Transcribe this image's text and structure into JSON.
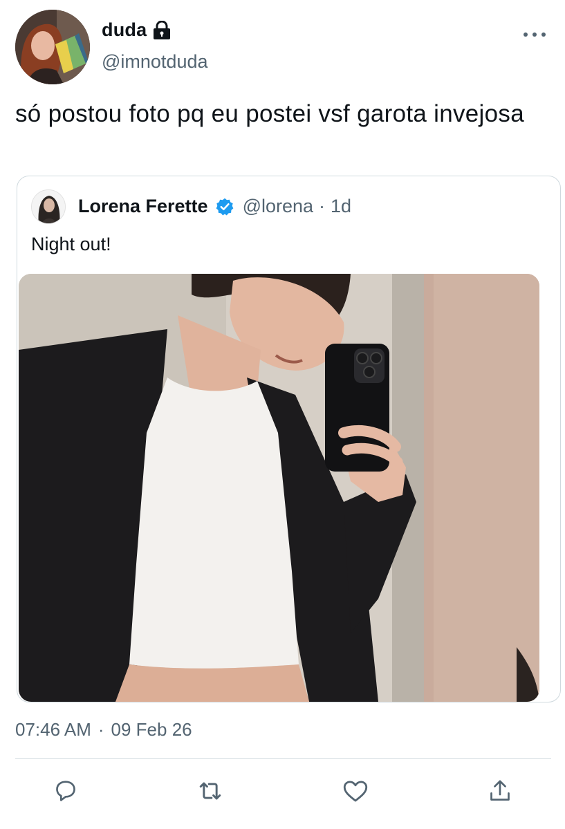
{
  "tweet": {
    "author": {
      "display_name": "duda",
      "handle": "@imnotduda",
      "protected": true,
      "avatar_icon": "profile-photo"
    },
    "text": "só postou foto pq eu postei vsf garota invejosa",
    "timestamp": {
      "time": "07:46 AM",
      "separator": "·",
      "date": "09 Feb 26"
    },
    "more_icon": "more-horizontal-icon"
  },
  "quoted_tweet": {
    "author": {
      "display_name": "Lorena Ferette",
      "handle": "@lorena",
      "verified": true,
      "avatar_icon": "profile-photo"
    },
    "separator": "·",
    "age": "1d",
    "text": "Night out!",
    "media_icon": "photo"
  },
  "actions": [
    {
      "name": "reply",
      "icon": "reply-icon"
    },
    {
      "name": "retweet",
      "icon": "retweet-icon"
    },
    {
      "name": "like",
      "icon": "heart-icon"
    },
    {
      "name": "share",
      "icon": "share-icon"
    }
  ],
  "colors": {
    "text_primary": "#0f1419",
    "text_secondary": "#536471",
    "border": "#cfd9de",
    "verified_blue": "#1d9bf0"
  }
}
